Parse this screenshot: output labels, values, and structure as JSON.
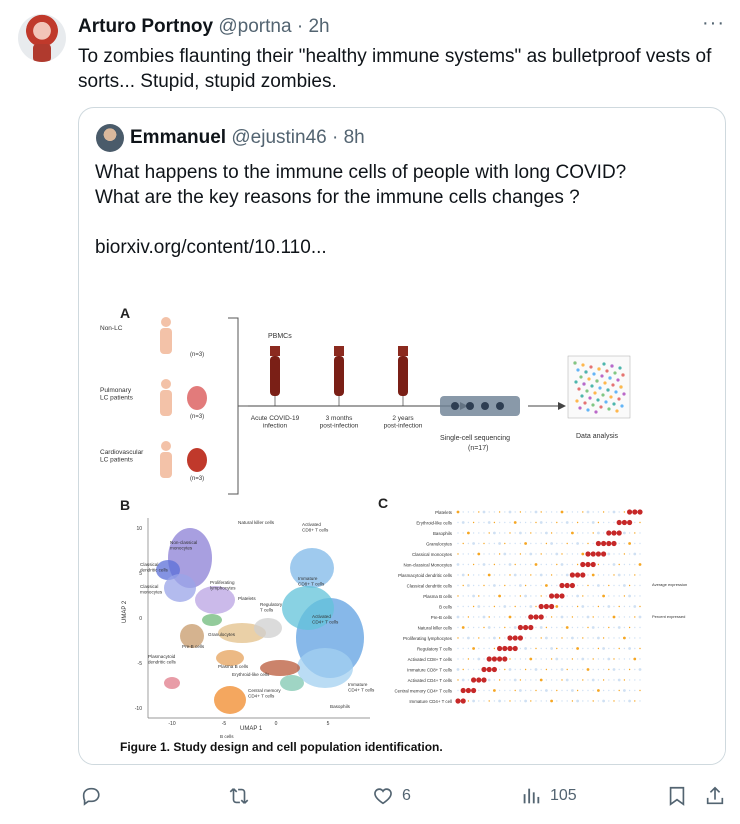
{
  "tweet": {
    "author_name": "Arturo Portnoy",
    "author_handle": "@portna",
    "separator": "·",
    "time": "2h",
    "more_label": "···",
    "text": "To zombies flaunting their \"healthy immune systems\" as bulletproof vests of sorts... Stupid, stupid zombies."
  },
  "quoted": {
    "author_name": "Emmanuel",
    "author_handle": "@ejustin46",
    "separator": "·",
    "time": "8h",
    "text": "What happens to the immune cells of people with long COVID?\nWhat are the key reasons for the immune cells changes ?\n\nbiorxiv.org/content/10.110..."
  },
  "figure": {
    "caption": "Figure 1. Study design and cell population identification.",
    "panel_a": {
      "label": "A",
      "groups": [
        {
          "name": "Non-LC",
          "n": "(n=3)"
        },
        {
          "name": "Pulmonary\nLC patients",
          "n": "(n=3)"
        },
        {
          "name": "Cardiovascular\nLC patients",
          "n": "(n=3)"
        }
      ],
      "pbmcs": "PBMCs",
      "timepoints": [
        "Acute COVID-19\ninfection",
        "3 months\npost-infection",
        "2 years\npost-infection"
      ],
      "sequencing": "Single-cell sequencing",
      "sequencing_n": "(n=17)",
      "analysis": "Data analysis"
    },
    "panel_b": {
      "label": "B",
      "xlabel": "UMAP 1",
      "ylabel": "UMAP 2",
      "xticks": [
        "-10",
        "-5",
        "0",
        "5"
      ],
      "yticks": [
        "10",
        "5",
        "0",
        "-5",
        "-10"
      ],
      "clusters": [
        "Natural killer cells",
        "Non-classical\nmonocytes",
        "Classical\ndendritic cells",
        "Classical\nmonocytes",
        "Proliferating\nlymphocytes",
        "Platelets",
        "Regulatory\nT cells",
        "Activated\nCD8+ T cells",
        "Immature\nCD8+ T cells",
        "Activated\nCD4+ T cells",
        "Granulocytes",
        "Pre-B cells",
        "Plasmacytoid\ndendritic cells",
        "Plasma B cells",
        "Erythroid-like cells",
        "Central memory\nCD4+ T cells",
        "Immature\nCD4+ T cells",
        "Basophils",
        "B cells"
      ]
    },
    "panel_c": {
      "label": "C",
      "rows": [
        "Platelets",
        "Erythroid-like cells",
        "Basophils",
        "Granulocytes",
        "Classical monocytes",
        "Non-classical Monocytes",
        "Plasmacytoid dendritic cells",
        "Classical dendritic cells",
        "Plasma B cells",
        "B cells",
        "Pre-B cells",
        "Natural killer cells",
        "Proliferating lymphocytes",
        "Regulatory T cells",
        "Activated CD8+ T cells",
        "Immature CD8+ T cells",
        "Activated CD4+ T cells",
        "Central memory CD4+ T cells",
        "Immature CD4+ T cell"
      ],
      "legend_title": "Average\nexpression",
      "legend_title2": "Percent\nexpressed"
    }
  },
  "actions": {
    "reply_count": "",
    "retweet_count": "",
    "like_count": "6",
    "views_count": "105"
  },
  "colors": {
    "text": "#0f1419",
    "secondary": "#536471",
    "border": "#cfd9de"
  }
}
